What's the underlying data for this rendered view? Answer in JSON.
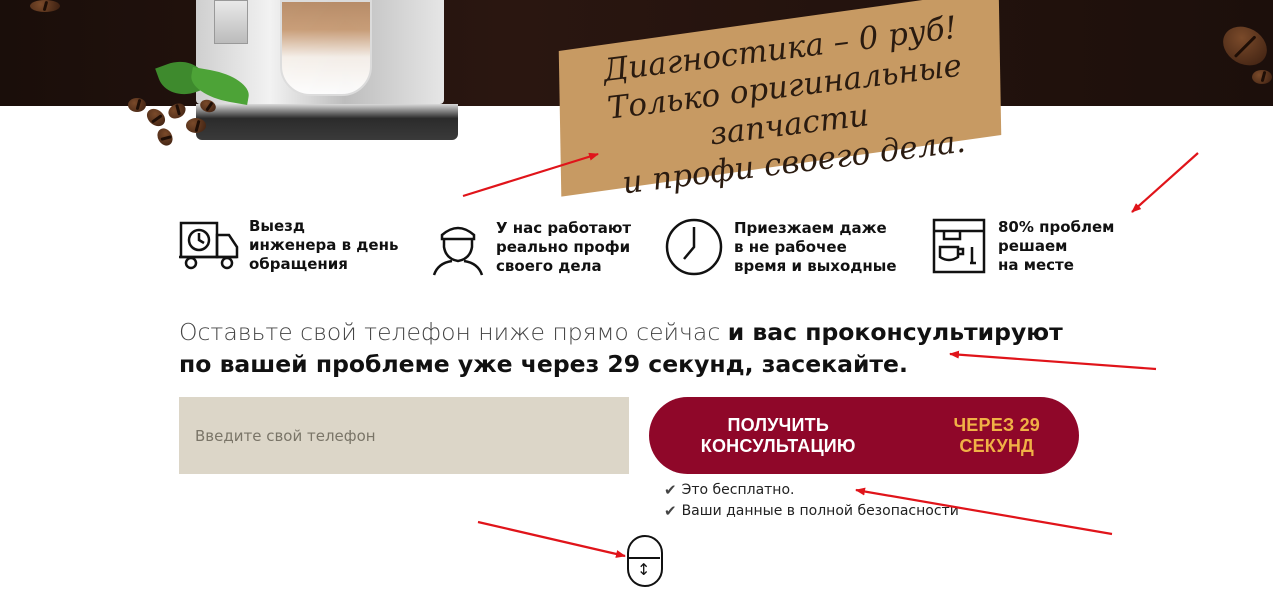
{
  "promo": {
    "line1": "Диагностика – 0 руб!",
    "line2": "Только оригинальные запчасти",
    "line3": "и профи своего дела."
  },
  "features": [
    {
      "icon": "delivery-truck-clock-icon",
      "label": "Выезд\nинженера в день\nобращения"
    },
    {
      "icon": "engineer-avatar-icon",
      "label": "У нас работают\nреально профи\nсвоего дела"
    },
    {
      "icon": "clock-icon",
      "label": "Приезжаем даже\nв не рабочее\nвремя и выходные"
    },
    {
      "icon": "coffee-machine-icon",
      "label": "80% проблем\nрешаем\nна месте"
    }
  ],
  "headline": {
    "light": "Оставьте свой телефон ниже прямо сейчас ",
    "strong": "и вас проконсультируют по вашей проблеме уже через 29 секунд, засекайте."
  },
  "form": {
    "phone_placeholder": "Введите свой телефон",
    "cta_main": "ПОЛУЧИТЬ КОНСУЛЬТАЦИЮ",
    "cta_accent": "ЧЕРЕЗ 29 СЕКУНД"
  },
  "notes": [
    "Это бесплатно.",
    "Ваши данные в полной безопасности"
  ],
  "colors": {
    "cta_bg": "#8f0729",
    "cta_accent": "#f0b146",
    "input_bg": "#dcd6c8",
    "plaque": "#c79a63",
    "annotation_arrows": "#e0141a"
  }
}
